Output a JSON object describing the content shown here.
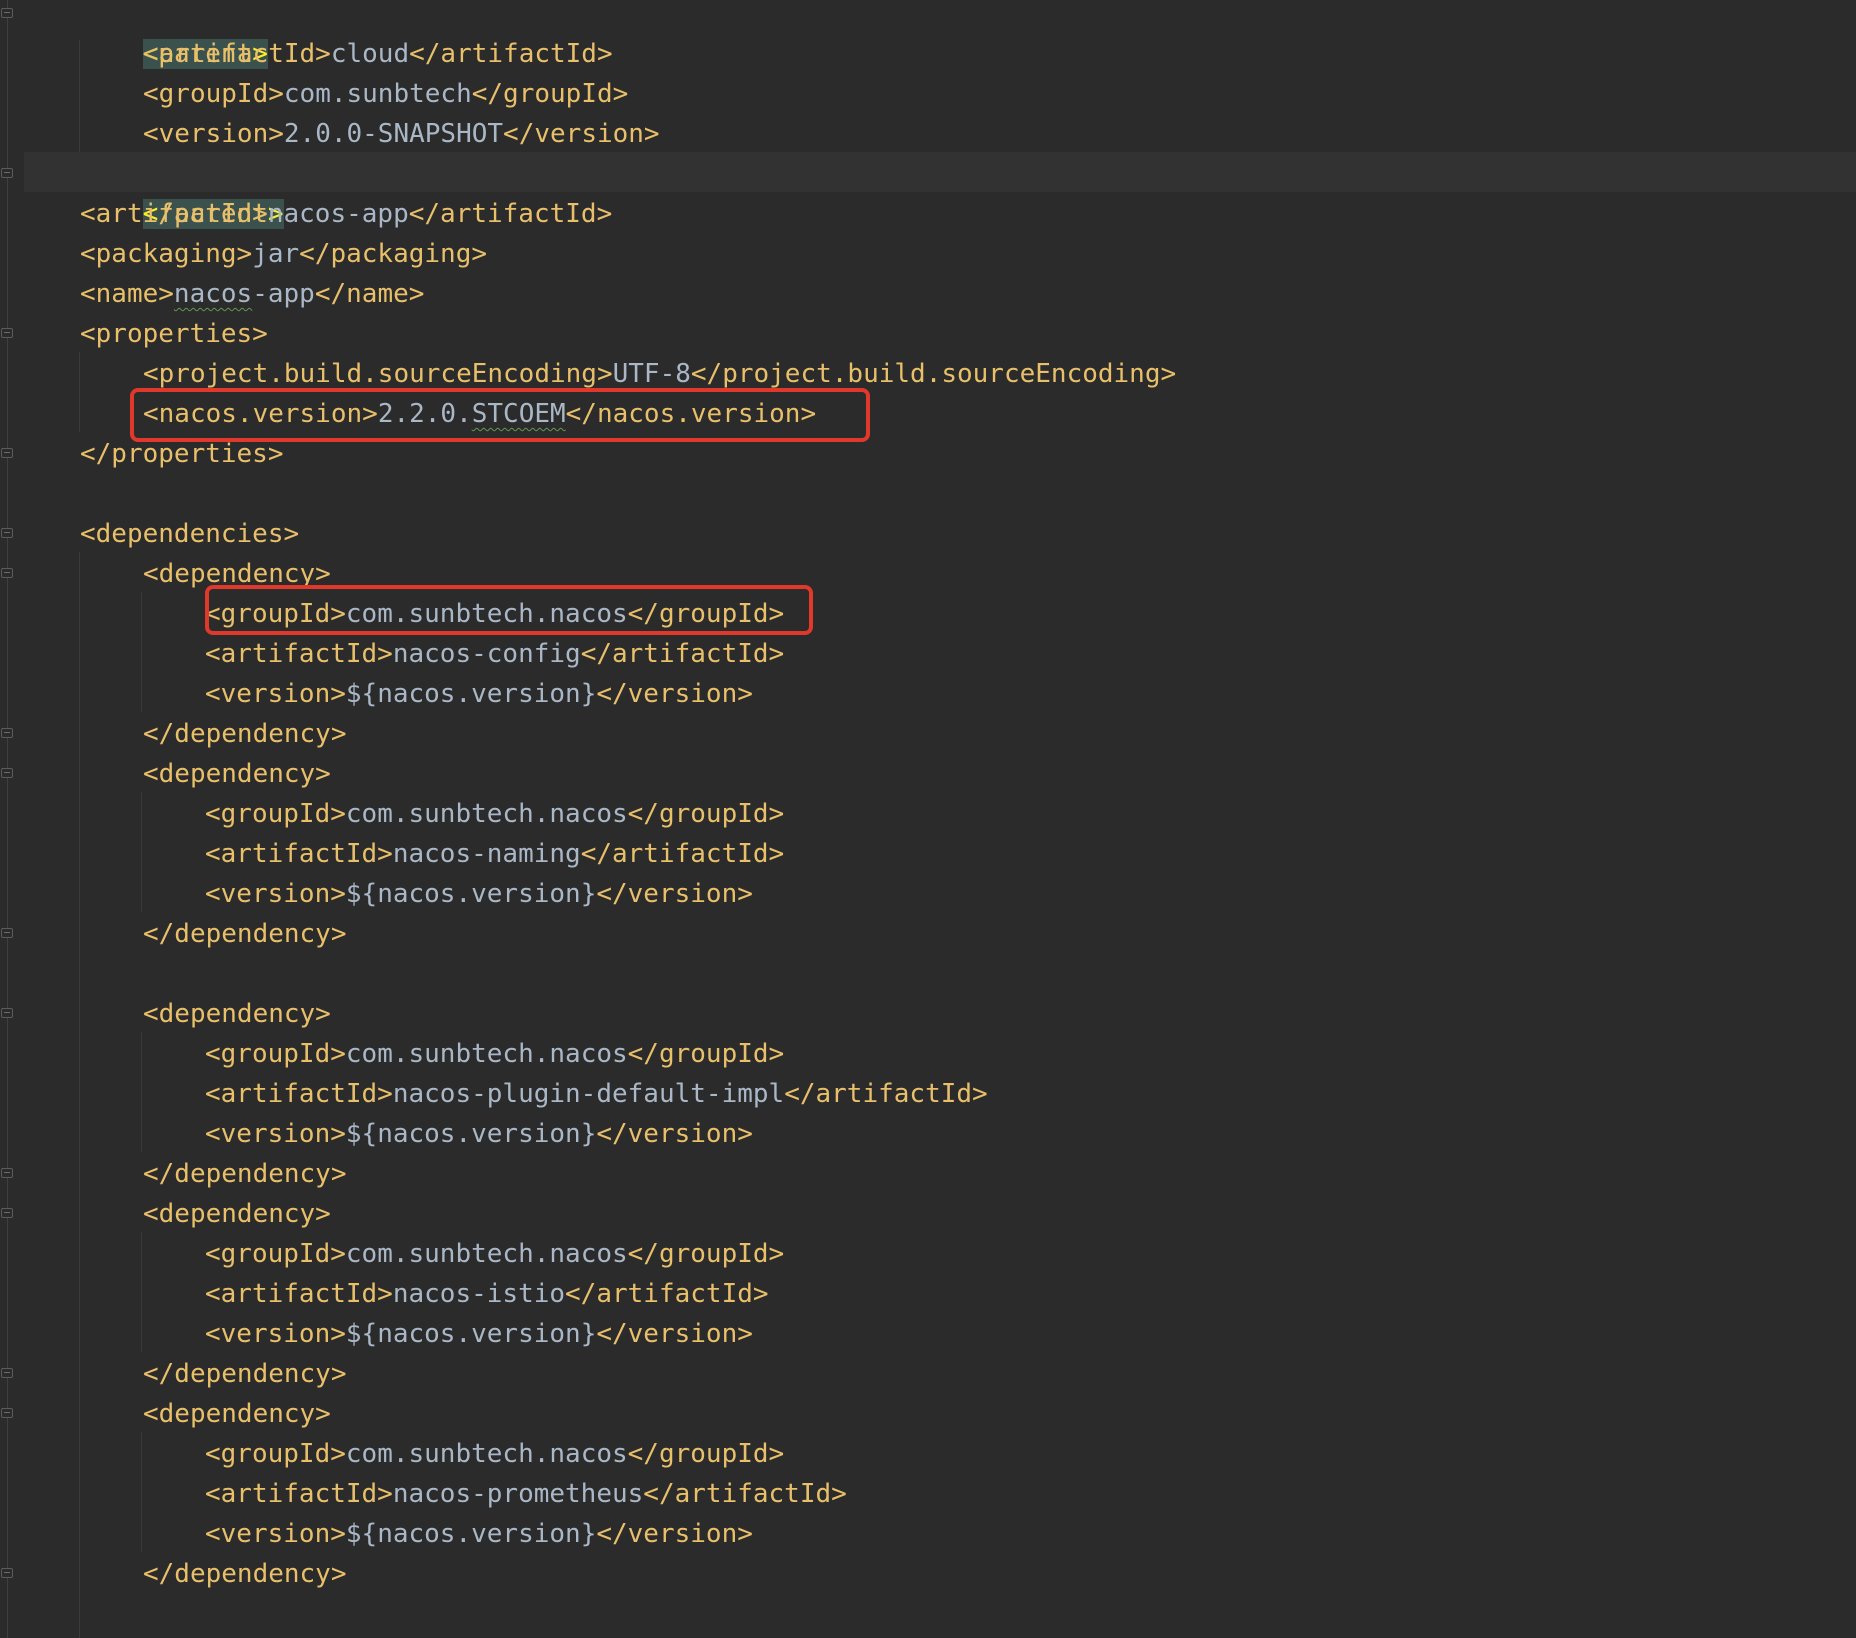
{
  "editor": {
    "language": "xml",
    "colors": {
      "background": "#2b2b2b",
      "tag": "#e8bf6a",
      "text": "#a9b7c6",
      "current_line": "#323232",
      "matched_tag_bg": "#3b514d",
      "annotation_box": "#e0392b"
    },
    "lines": {
      "l1": {
        "open": "<parent>"
      },
      "l2": {
        "open": "<artifactId>",
        "value": "cloud",
        "close": "</artifactId>"
      },
      "l3": {
        "open": "<groupId>",
        "value": "com.sunbtech",
        "close": "</groupId>"
      },
      "l4": {
        "open": "<version>",
        "value": "2.0.0-SNAPSHOT",
        "close": "</version>"
      },
      "l5": {
        "close": "</parent>"
      },
      "l6": {
        "open": "<artifactId>",
        "value": "nacos-app",
        "close": "</artifactId>"
      },
      "l7": {
        "open": "<packaging>",
        "value": "jar",
        "close": "</packaging>"
      },
      "l8": {
        "open": "<name>",
        "value_a": "nacos",
        "value_b": "-app",
        "close": "</name>"
      },
      "l9": {
        "open": "<properties>"
      },
      "l10": {
        "open": "<project.build.sourceEncoding>",
        "value": "UTF-8",
        "close": "</project.build.sourceEncoding>"
      },
      "l11": {
        "open": "<nacos.version>",
        "value_a": "2.2.0.",
        "value_b": "STCOEM",
        "close": "</nacos.version>"
      },
      "l12": {
        "close": "</properties>"
      },
      "l14": {
        "open": "<dependencies>"
      },
      "l15": {
        "open": "<dependency>"
      },
      "l16": {
        "open": "<groupId>",
        "value": "com.sunbtech.nacos",
        "close": "</groupId>"
      },
      "l17": {
        "open": "<artifactId>",
        "value": "nacos-config",
        "close": "</artifactId>"
      },
      "l18": {
        "open": "<version>",
        "value": "${nacos.version}",
        "close": "</version>"
      },
      "l19": {
        "close": "</dependency>"
      },
      "l20": {
        "open": "<dependency>"
      },
      "l21": {
        "open": "<groupId>",
        "value": "com.sunbtech.nacos",
        "close": "</groupId>"
      },
      "l22": {
        "open": "<artifactId>",
        "value": "nacos-naming",
        "close": "</artifactId>"
      },
      "l23": {
        "open": "<version>",
        "value": "${nacos.version}",
        "close": "</version>"
      },
      "l24": {
        "close": "</dependency>"
      },
      "l26": {
        "open": "<dependency>"
      },
      "l27": {
        "open": "<groupId>",
        "value": "com.sunbtech.nacos",
        "close": "</groupId>"
      },
      "l28": {
        "open": "<artifactId>",
        "value": "nacos-plugin-default-impl",
        "close": "</artifactId>"
      },
      "l29": {
        "open": "<version>",
        "value": "${nacos.version}",
        "close": "</version>"
      },
      "l30": {
        "close": "</dependency>"
      },
      "l31": {
        "open": "<dependency>"
      },
      "l32": {
        "open": "<groupId>",
        "value": "com.sunbtech.nacos",
        "close": "</groupId>"
      },
      "l33": {
        "open": "<artifactId>",
        "value": "nacos-istio",
        "close": "</artifactId>"
      },
      "l34": {
        "open": "<version>",
        "value": "${nacos.version}",
        "close": "</version>"
      },
      "l35": {
        "close": "</dependency>"
      },
      "l36": {
        "open": "<dependency>"
      },
      "l37": {
        "open": "<groupId>",
        "value": "com.sunbtech.nacos",
        "close": "</groupId>"
      },
      "l38": {
        "open": "<artifactId>",
        "value": "nacos-prometheus",
        "close": "</artifactId>"
      },
      "l39": {
        "open": "<version>",
        "value": "${nacos.version}",
        "close": "</version>"
      },
      "l40": {
        "close": "</dependency>"
      }
    }
  }
}
